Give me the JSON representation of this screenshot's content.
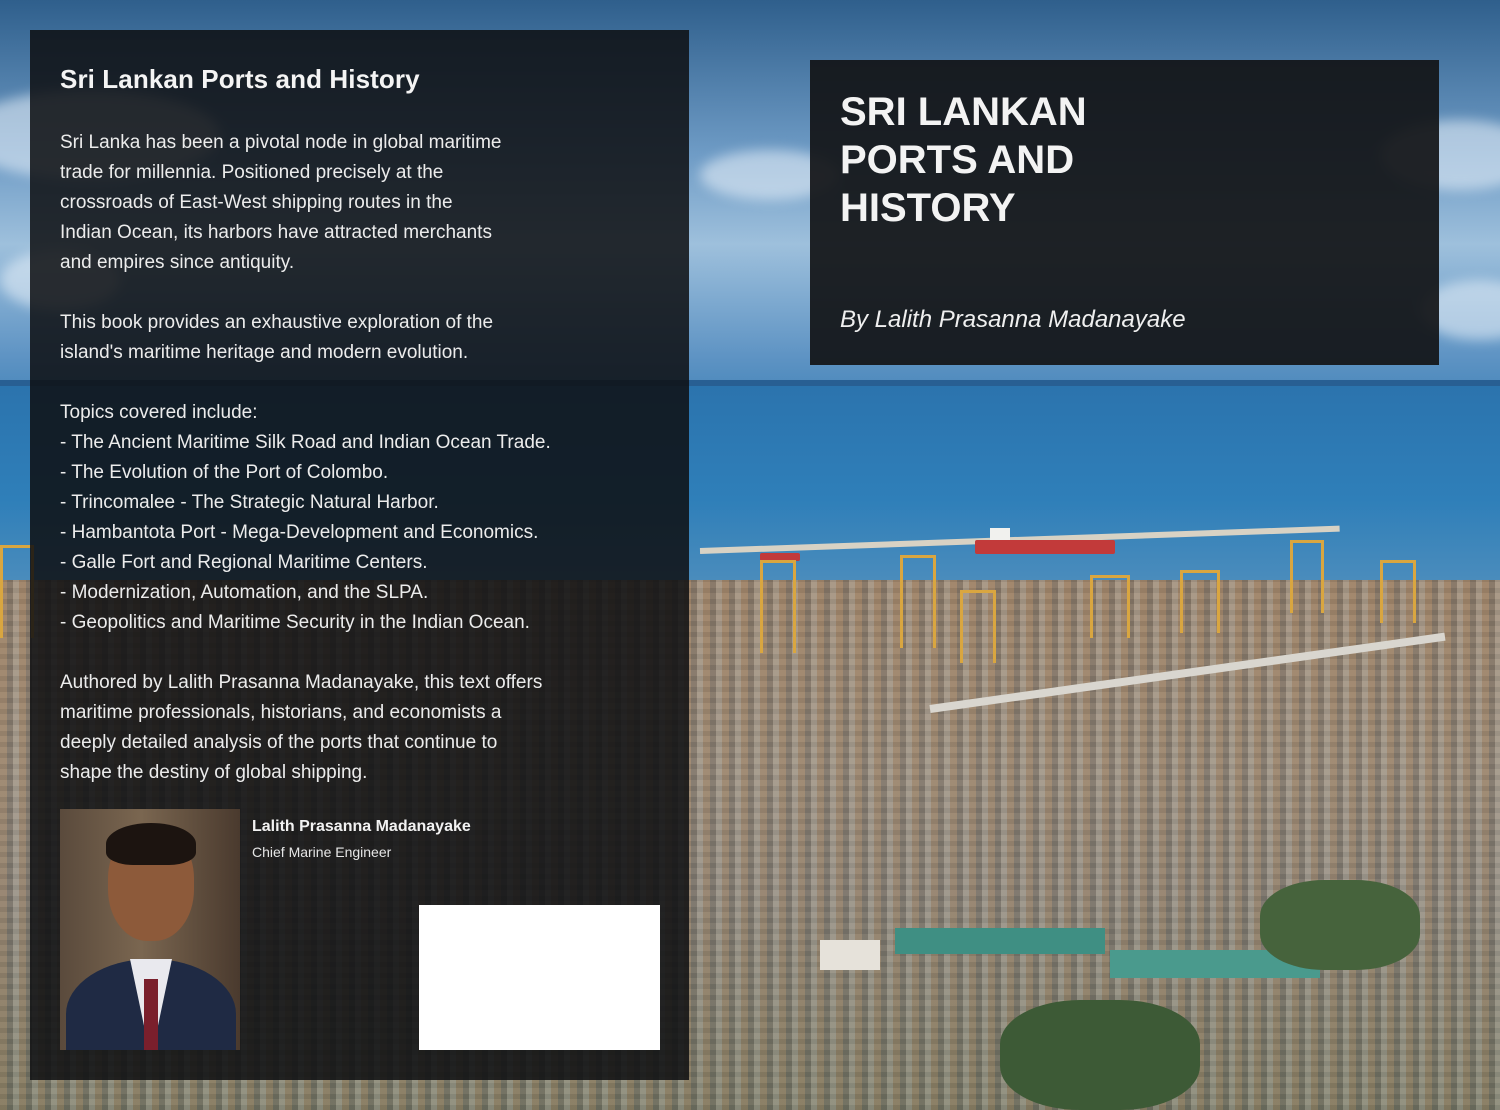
{
  "back_cover": {
    "title": "Sri Lankan Ports and History",
    "intro_lines": [
      "Sri Lanka has been a pivotal node in global maritime",
      "trade for millennia. Positioned precisely at the",
      "crossroads of East-West shipping routes in the",
      "Indian Ocean, its harbors have attracted merchants",
      "and empires since antiquity."
    ],
    "purpose_lines": [
      "This book provides an exhaustive exploration of the",
      "island's maritime heritage and modern evolution."
    ],
    "topics_heading": "Topics covered include:",
    "topics": [
      "- The Ancient Maritime Silk Road and Indian Ocean Trade.",
      "- The Evolution of the Port of Colombo.",
      "- Trincomalee - The Strategic Natural Harbor.",
      "- Hambantota Port - Mega-Development and Economics.",
      "- Galle Fort and Regional Maritime Centers.",
      "- Modernization, Automation, and the SLPA.",
      "- Geopolitics and Maritime Security in the Indian Ocean."
    ],
    "closing_lines": [
      "Authored by Lalith Prasanna Madanayake, this text offers",
      "maritime professionals, historians, and economists a",
      "deeply detailed analysis of the ports that continue to",
      "shape the destiny of global shipping."
    ],
    "author_name": "Lalith Prasanna Madanayake",
    "author_role": "Chief Marine Engineer"
  },
  "front_cover": {
    "title_lines": [
      "SRI LANKAN",
      "PORTS AND",
      "HISTORY"
    ],
    "byline": "By Lalith Prasanna Madanayake"
  },
  "colors": {
    "panel": "#0e0f12",
    "text": "#f4f4f4",
    "sea": "#2f7fb9",
    "crane": "#d9a640"
  }
}
